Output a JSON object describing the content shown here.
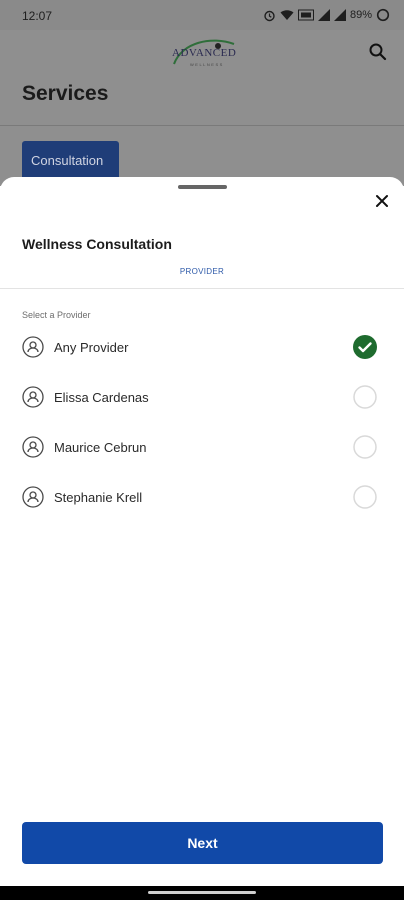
{
  "status_bar": {
    "time": "12:07",
    "battery": "89%",
    "icons": [
      "alarm-icon",
      "wifi-icon",
      "data-icon",
      "signal-icon",
      "signal-icon",
      "battery-icon"
    ]
  },
  "header": {
    "logo_text": "ADVANCED",
    "logo_sub": "WELLNESS",
    "title": "Services",
    "search_icon": "search-icon"
  },
  "background_tab": {
    "label": "Consultation"
  },
  "sheet": {
    "title": "Wellness Consultation",
    "step_label": "PROVIDER",
    "section_label": "Select a Provider",
    "providers": [
      {
        "name": "Any Provider",
        "selected": true
      },
      {
        "name": "Elissa Cardenas",
        "selected": false
      },
      {
        "name": "Maurice Cebrun",
        "selected": false
      },
      {
        "name": "Stephanie Krell",
        "selected": false
      }
    ],
    "next_label": "Next"
  },
  "colors": {
    "primary": "#1149a8",
    "selected_check": "#1e6b2e",
    "step_label": "#2e5aa9"
  }
}
